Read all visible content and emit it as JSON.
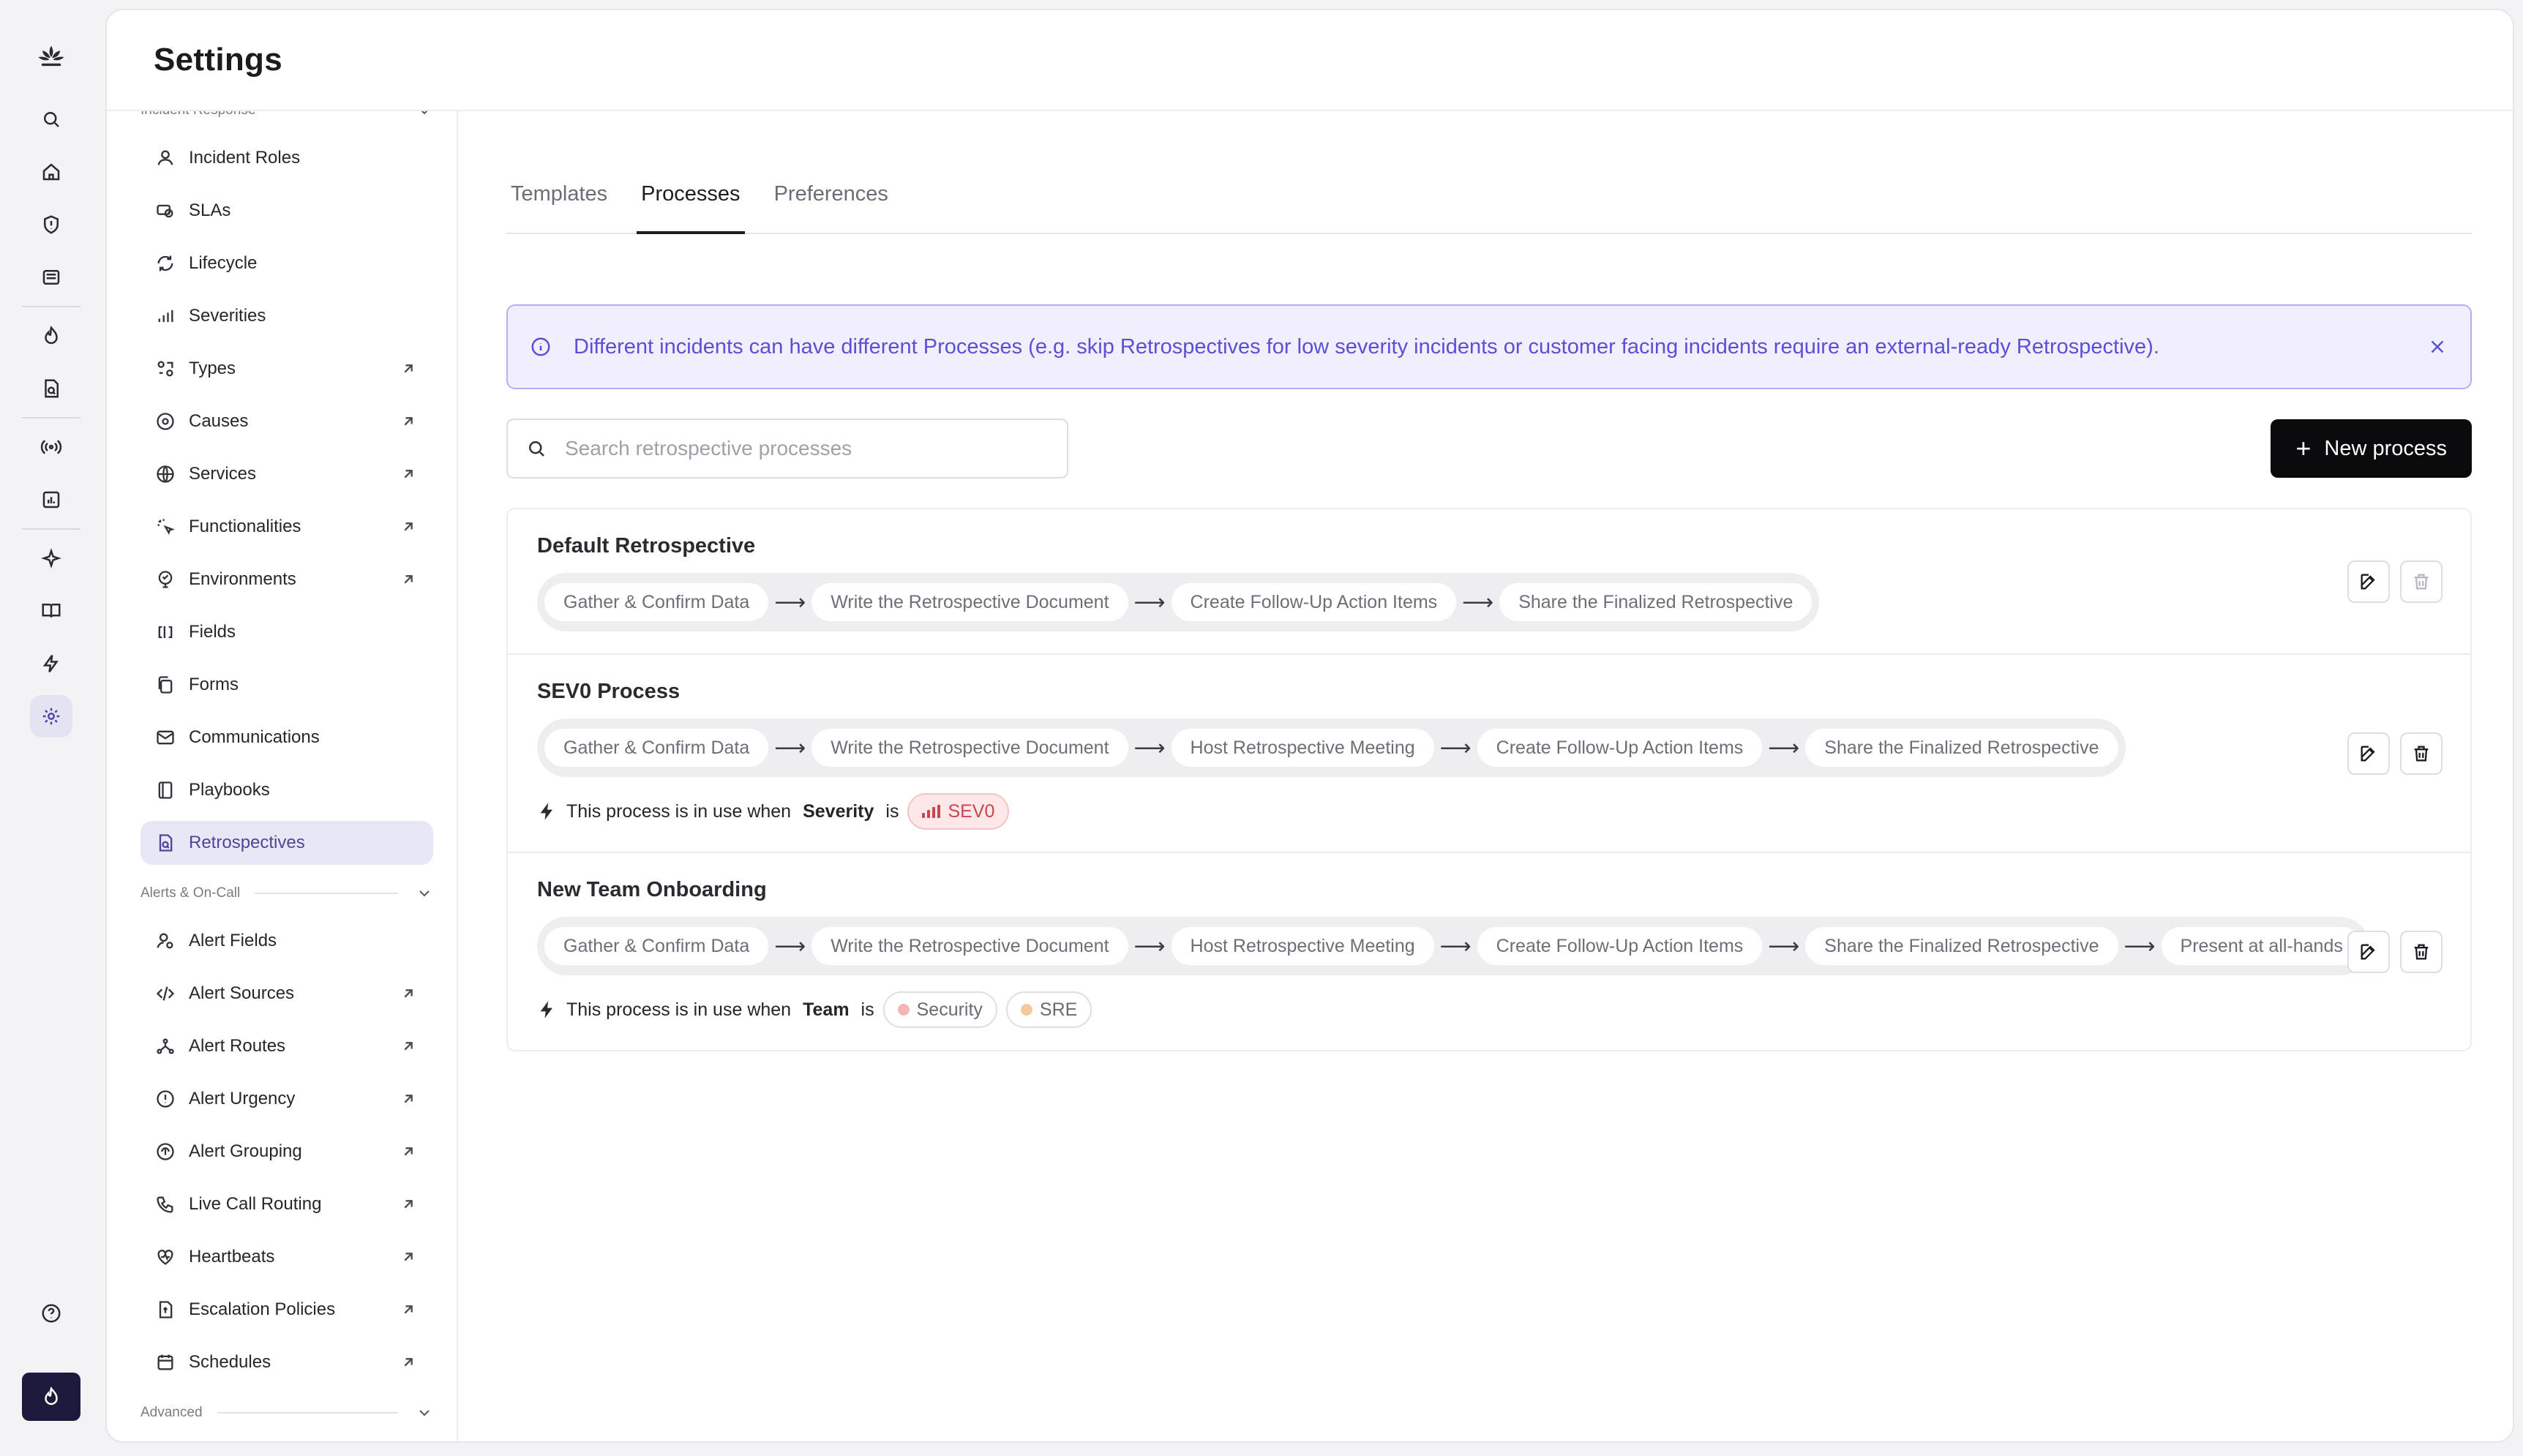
{
  "header": {
    "title": "Settings"
  },
  "sidebar": {
    "top_group_label": "Incident Response",
    "incident_items": [
      {
        "label": "Incident Roles",
        "icon": "user-icon",
        "external": false
      },
      {
        "label": "SLAs",
        "icon": "sla-icon",
        "external": false
      },
      {
        "label": "Lifecycle",
        "icon": "refresh-icon",
        "external": false
      },
      {
        "label": "Severities",
        "icon": "signal-bars-icon",
        "external": false
      },
      {
        "label": "Types",
        "icon": "types-icon",
        "external": true
      },
      {
        "label": "Causes",
        "icon": "target-icon",
        "external": true
      },
      {
        "label": "Services",
        "icon": "globe-icon",
        "external": true
      },
      {
        "label": "Functionalities",
        "icon": "sparkle-cursor-icon",
        "external": true
      },
      {
        "label": "Environments",
        "icon": "environment-icon",
        "external": true
      },
      {
        "label": "Fields",
        "icon": "field-icon",
        "external": false
      },
      {
        "label": "Forms",
        "icon": "document-copy-icon",
        "external": false
      },
      {
        "label": "Communications",
        "icon": "mail-icon",
        "external": false
      },
      {
        "label": "Playbooks",
        "icon": "book-icon",
        "external": false
      },
      {
        "label": "Retrospectives",
        "icon": "retro-doc-icon",
        "external": false,
        "active": true
      }
    ],
    "alerts_group_label": "Alerts & On-Call",
    "alert_items": [
      {
        "label": "Alert Fields",
        "icon": "user-gear-icon",
        "external": false
      },
      {
        "label": "Alert Sources",
        "icon": "code-icon",
        "external": true
      },
      {
        "label": "Alert Routes",
        "icon": "route-icon",
        "external": true
      },
      {
        "label": "Alert Urgency",
        "icon": "alert-circle-icon",
        "external": true
      },
      {
        "label": "Alert Grouping",
        "icon": "grouping-icon",
        "external": true
      },
      {
        "label": "Live Call Routing",
        "icon": "phone-icon",
        "external": true
      },
      {
        "label": "Heartbeats",
        "icon": "heart-pulse-icon",
        "external": true
      },
      {
        "label": "Escalation Policies",
        "icon": "escalation-doc-icon",
        "external": true
      },
      {
        "label": "Schedules",
        "icon": "calendar-icon",
        "external": true
      }
    ],
    "advanced_group_label": "Advanced"
  },
  "tabs": [
    {
      "label": "Templates",
      "active": false
    },
    {
      "label": "Processes",
      "active": true
    },
    {
      "label": "Preferences",
      "active": false
    }
  ],
  "banner": {
    "text": "Different incidents can have different Processes (e.g. skip Retrospectives for low severity incidents or customer facing incidents require an external-ready Retrospective)."
  },
  "search": {
    "placeholder": "Search retrospective processes",
    "value": ""
  },
  "new_button": {
    "label": "New process"
  },
  "processes": [
    {
      "name": "Default Retrospective",
      "steps": [
        "Gather & Confirm Data",
        "Write the Retrospective Document",
        "Create Follow-Up Action Items",
        "Share the Finalized Retrospective"
      ],
      "delete_enabled": false
    },
    {
      "name": "SEV0 Process",
      "steps": [
        "Gather & Confirm Data",
        "Write the Retrospective Document",
        "Host Retrospective Meeting",
        "Create Follow-Up Action Items",
        "Share the Finalized Retrospective"
      ],
      "condition": {
        "prefix": "This process is in use when",
        "field": "Severity",
        "op": "is",
        "values": [
          {
            "label": "SEV0",
            "kind": "severity"
          }
        ]
      },
      "delete_enabled": true
    },
    {
      "name": "New Team Onboarding",
      "steps": [
        "Gather & Confirm Data",
        "Write the Retrospective Document",
        "Host Retrospective Meeting",
        "Create Follow-Up Action Items",
        "Share the Finalized Retrospective",
        "Present at all-hands"
      ],
      "condition": {
        "prefix": "This process is in use when",
        "field": "Team",
        "op": "is",
        "values": [
          {
            "label": "Security",
            "kind": "team",
            "dot": "#f3b7b7"
          },
          {
            "label": "SRE",
            "kind": "team",
            "dot": "#f5c99a"
          }
        ]
      },
      "delete_enabled": true
    }
  ],
  "colors": {
    "accent": "#5b4fd6",
    "active_bg": "#e8e7f5",
    "severity": "#c9464f",
    "rail_button": "#1b1a3c"
  }
}
